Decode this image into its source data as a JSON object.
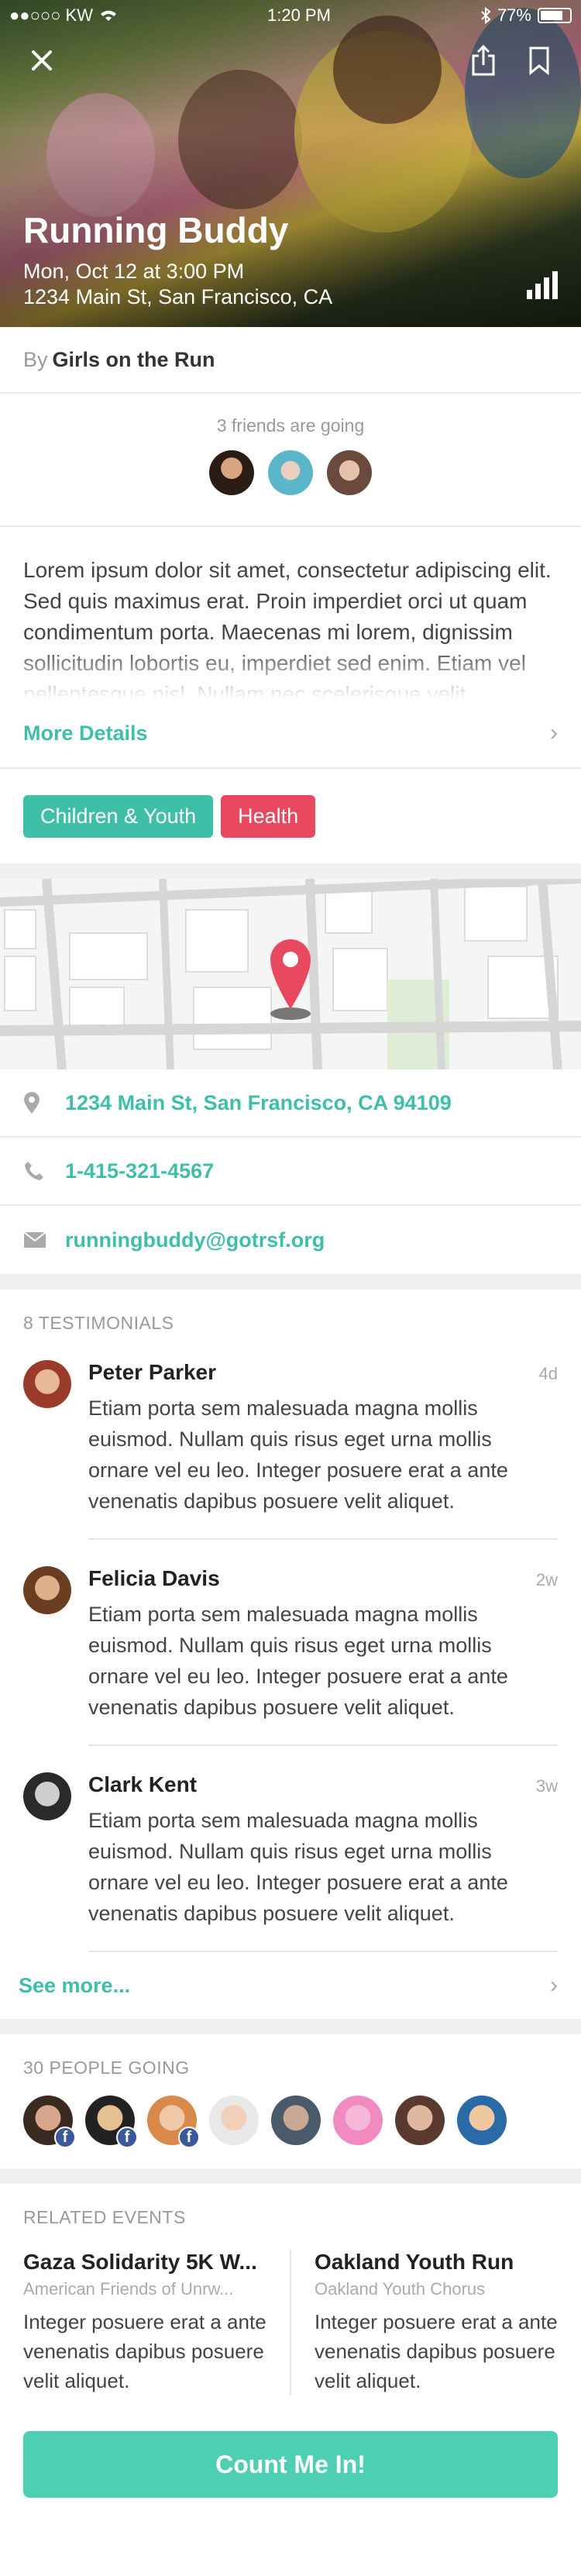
{
  "status_bar": {
    "carrier": "●●○○○ KW",
    "time": "1:20 PM",
    "battery": "77%",
    "battery_level": 0.77
  },
  "event": {
    "title": "Running Buddy",
    "datetime": "Mon, Oct 12 at 3:00 PM",
    "address": "1234 Main St, San Francisco, CA"
  },
  "organizer": {
    "prefix": "By",
    "name": "Girls on the Run"
  },
  "friends": {
    "label": "3 friends are going"
  },
  "description": "Lorem ipsum dolor sit amet, consectetur adipiscing elit. Sed quis maximus erat. Proin imperdiet orci ut quam condimentum porta. Maecenas mi lorem, dignissim sollicitudin lobortis eu, imperdiet sed enim. Etiam vel pellentesque nisl. Nullam nec scelerisque velit.",
  "more_details": "More Details",
  "tags": [
    {
      "label": "Children & Youth",
      "color": "#3fbfa8"
    },
    {
      "label": "Health",
      "color": "#e8495e"
    }
  ],
  "contact": {
    "address": "1234 Main St, San Francisco, CA 94109",
    "phone": "1-415-321-4567",
    "email": "runningbuddy@gotrsf.org"
  },
  "testimonials": {
    "label": "8 TESTIMONIALS",
    "items": [
      {
        "name": "Peter Parker",
        "time": "4d",
        "text": "Etiam porta sem malesuada magna mollis euismod. Nullam quis risus eget urna mollis ornare vel eu leo. Integer posuere erat a ante venenatis dapibus posuere velit aliquet."
      },
      {
        "name": "Felicia Davis",
        "time": "2w",
        "text": "Etiam porta sem malesuada magna mollis euismod. Nullam quis risus eget urna mollis ornare vel eu leo. Integer posuere erat a ante venenatis dapibus posuere velit aliquet."
      },
      {
        "name": "Clark Kent",
        "time": "3w",
        "text": "Etiam porta sem malesuada magna mollis euismod. Nullam quis risus eget urna mollis ornare vel eu leo. Integer posuere erat a ante venenatis dapibus posuere velit aliquet."
      }
    ],
    "see_more": "See more..."
  },
  "people_going": {
    "label": "30 PEOPLE GOING"
  },
  "related": {
    "label": "RELATED EVENTS",
    "items": [
      {
        "title": "Gaza Solidarity 5K W...",
        "org": "American Friends of Unrw...",
        "text": "Integer posuere erat a ante venenatis dapibus posuere velit aliquet."
      },
      {
        "title": "Oakland Youth Run",
        "org": "Oakland Youth Chorus",
        "text": "Integer posuere erat a ante venenatis dapibus posuere velit aliquet."
      }
    ]
  },
  "cta": "Count Me In!",
  "colors": {
    "accent": "#3fbfa8",
    "health": "#e8495e",
    "cta": "#4ecfb4",
    "facebook": "#3b5998"
  }
}
